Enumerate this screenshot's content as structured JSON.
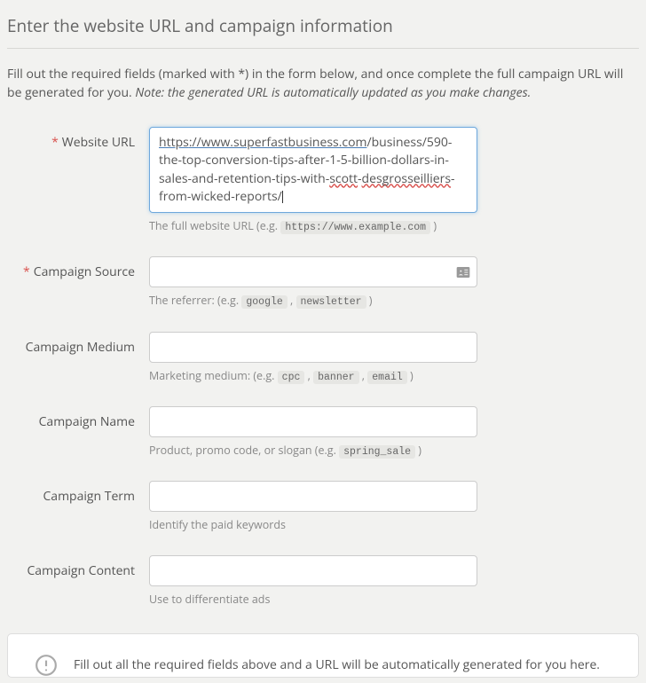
{
  "header": {
    "title": "Enter the website URL and campaign information"
  },
  "intro": {
    "text": "Fill out the required fields (marked with *) in the form below, and once complete the full campaign URL will be generated for you. ",
    "note": "Note: the generated URL is automatically updated as you make changes."
  },
  "fields": {
    "website_url": {
      "label": "Website URL",
      "required": true,
      "value_link": "https",
      "value_rest1": "://www.superfastbusiness.com",
      "value_rest2": "/business/590-the-top-conversion-tips-after-1-5-billion-dollars-in-sales-and-retention-tips-with-",
      "value_err1": "scott",
      "value_dash": "-",
      "value_err2": "desgrosseilliers",
      "value_rest3": "-from-wicked-reports/",
      "help_prefix": "The full website URL (e.g. ",
      "help_code": "https://www.example.com",
      "help_suffix": " )"
    },
    "campaign_source": {
      "label": "Campaign Source",
      "required": true,
      "help_prefix": "The referrer: (e.g. ",
      "help_code1": "google",
      "help_sep": " , ",
      "help_code2": "newsletter",
      "help_suffix": " )"
    },
    "campaign_medium": {
      "label": "Campaign Medium",
      "required": false,
      "help_prefix": "Marketing medium: (e.g. ",
      "help_code1": "cpc",
      "help_code2": "banner",
      "help_code3": "email",
      "help_sep": " , ",
      "help_suffix": " )"
    },
    "campaign_name": {
      "label": "Campaign Name",
      "required": false,
      "help_prefix": "Product, promo code, or slogan (e.g. ",
      "help_code": "spring_sale",
      "help_suffix": " )"
    },
    "campaign_term": {
      "label": "Campaign Term",
      "required": false,
      "help": "Identify the paid keywords"
    },
    "campaign_content": {
      "label": "Campaign Content",
      "required": false,
      "help": "Use to differentiate ads"
    }
  },
  "result": {
    "text": "Fill out all the required fields above and a URL will be automatically generated for you here."
  }
}
